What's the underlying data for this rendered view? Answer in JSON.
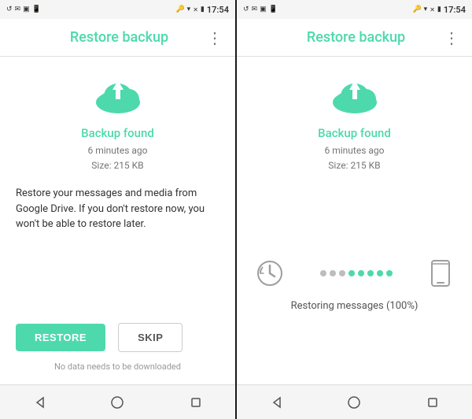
{
  "left_screen": {
    "status_bar": {
      "time": "17:54"
    },
    "app_bar": {
      "title": "Restore backup",
      "more_label": "⋮"
    },
    "cloud_icon": "cloud-upload",
    "backup_found_label": "Backup found",
    "backup_time": "6 minutes ago",
    "backup_size": "Size: 215 KB",
    "description": "Restore your messages and media from Google Drive. If you don't restore now, you won't be able to restore later.",
    "restore_button": "RESTORE",
    "skip_button": "SKIP",
    "no_data_label": "No data needs to be downloaded"
  },
  "right_screen": {
    "status_bar": {
      "time": "17:54"
    },
    "app_bar": {
      "title": "Restore backup",
      "more_label": "⋮"
    },
    "cloud_icon": "cloud-upload",
    "backup_found_label": "Backup found",
    "backup_time": "6 minutes ago",
    "backup_size": "Size: 215 KB",
    "restore_status": "Restoring messages (100%)",
    "dots": [
      {
        "color": "gray"
      },
      {
        "color": "gray"
      },
      {
        "color": "gray"
      },
      {
        "color": "green"
      },
      {
        "color": "green"
      },
      {
        "color": "green"
      },
      {
        "color": "green"
      },
      {
        "color": "green"
      }
    ]
  },
  "nav": {
    "back": "◁",
    "home": "○",
    "recent": "□"
  }
}
